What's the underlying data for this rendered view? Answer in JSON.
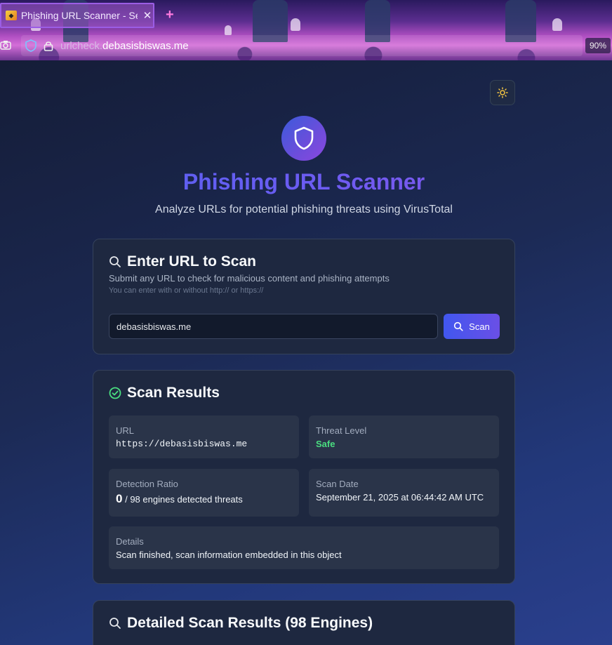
{
  "browser": {
    "tab_title": "Phishing URL Scanner - Se",
    "tab_close": "✕",
    "new_tab": "+",
    "url_prefix": "urlcheck.",
    "url_domain": "debasisbiswas.me",
    "zoom": "90%"
  },
  "page": {
    "title": "Phishing URL Scanner",
    "subtitle": "Analyze URLs for potential phishing threats using VirusTotal"
  },
  "scan": {
    "heading": "Enter URL to Scan",
    "description": "Submit any URL to check for malicious content and phishing attempts",
    "hint": "You can enter with or without http:// or https://",
    "input_value": "debasisbiswas.me",
    "button_label": "Scan"
  },
  "results": {
    "heading": "Scan Results",
    "url_label": "URL",
    "url_value": "https://debasisbiswas.me",
    "threat_label": "Threat Level",
    "threat_value": "Safe",
    "ratio_label": "Detection Ratio",
    "ratio_count": "0",
    "ratio_rest": "/ 98 engines detected threats",
    "date_label": "Scan Date",
    "date_value": "September 21, 2025 at 06:44:42 AM UTC",
    "details_label": "Details",
    "details_value": "Scan finished, scan information embedded in this object"
  },
  "detailed": {
    "heading": "Detailed Scan Results (98 Engines)"
  },
  "colors": {
    "accent": "#4f63f0",
    "safe": "#4ade80",
    "card_bg": "#1e2840"
  },
  "icons": [
    "camera-icon",
    "shield-icon",
    "lock-icon",
    "sun-icon",
    "search-icon",
    "check-circle-icon"
  ]
}
